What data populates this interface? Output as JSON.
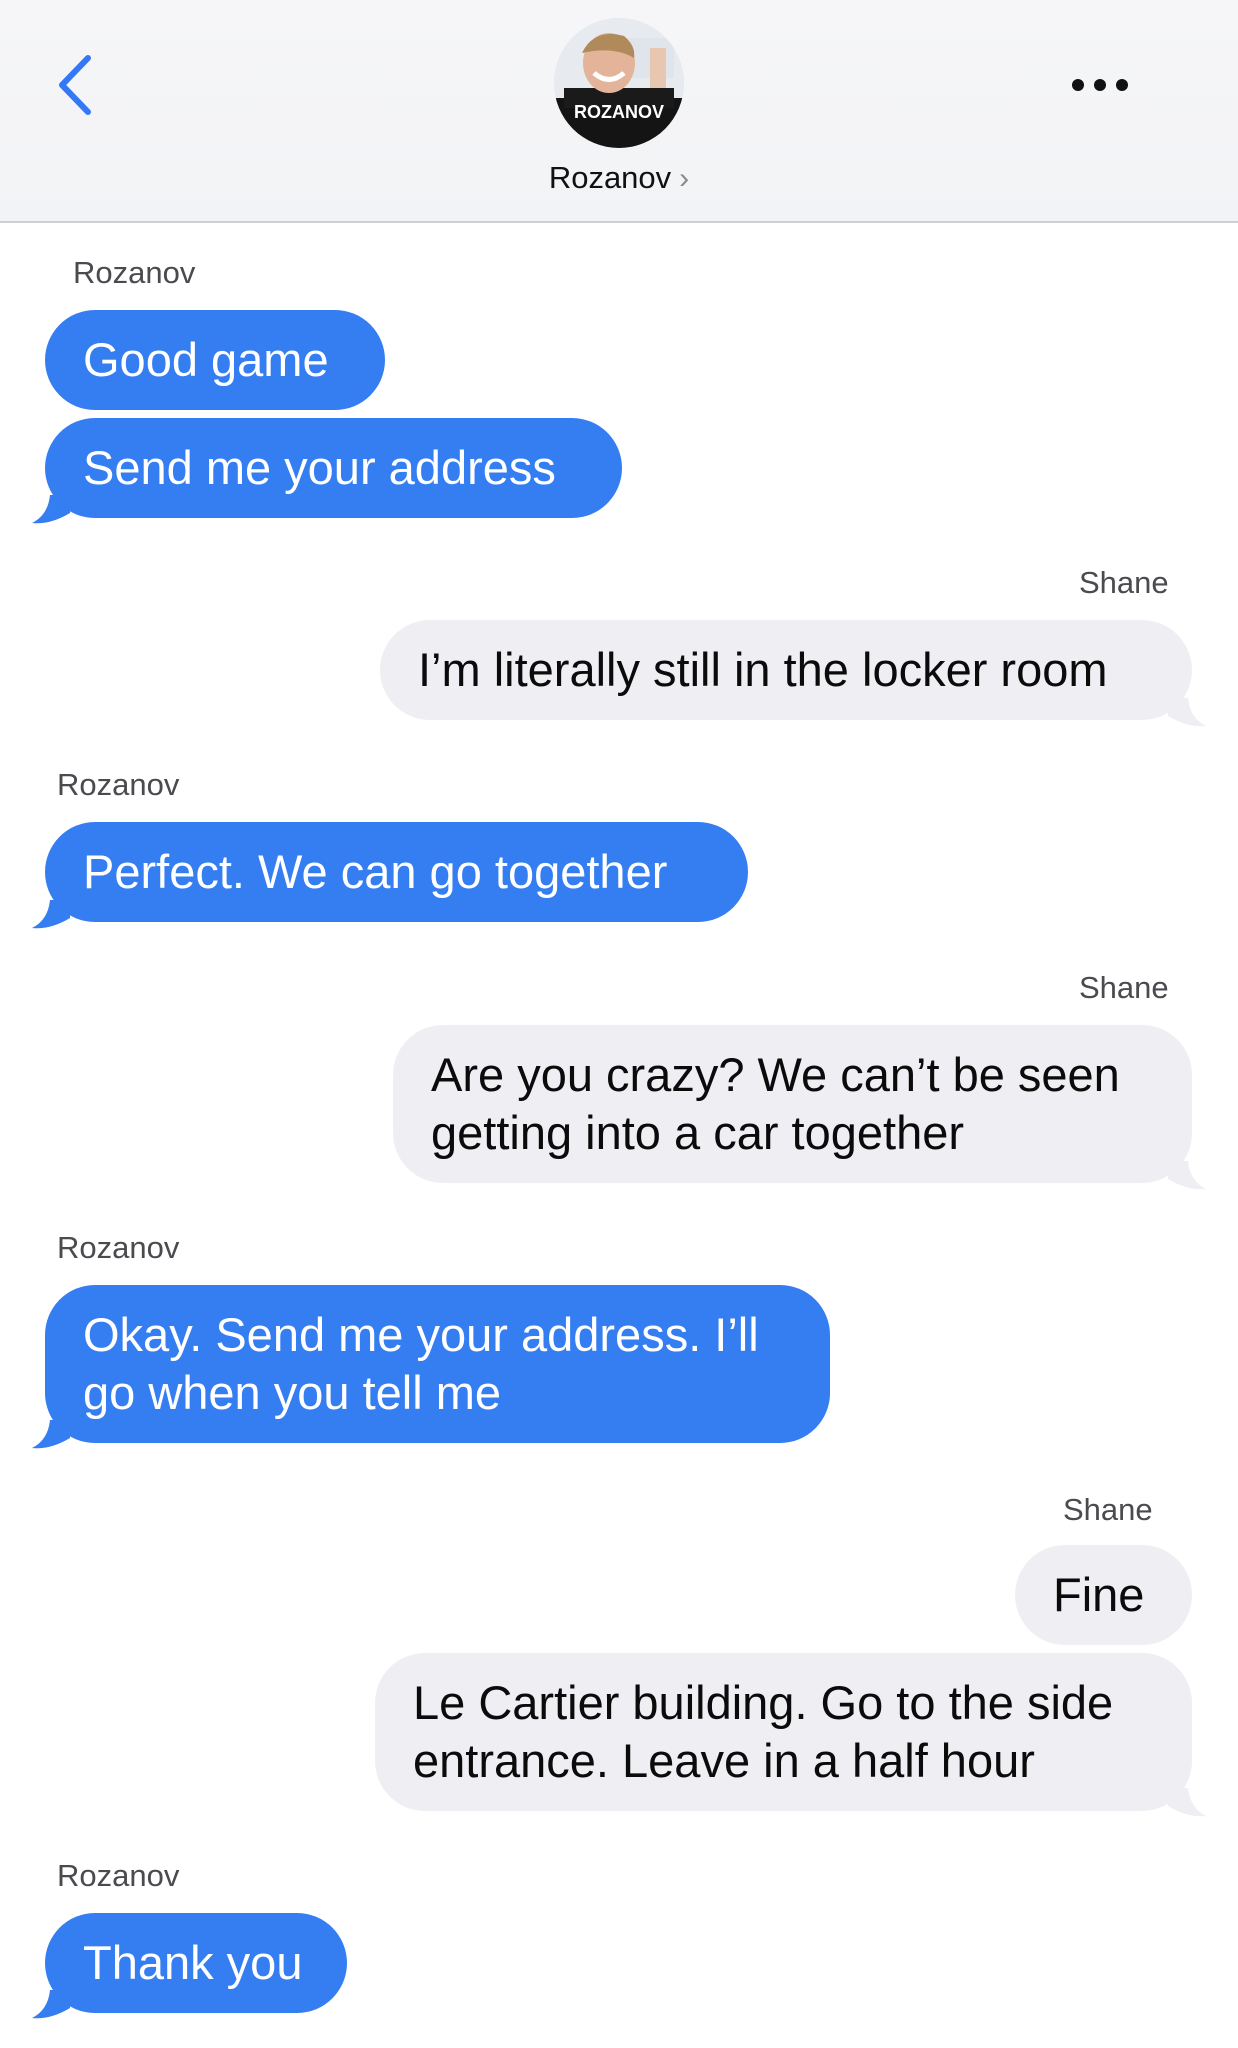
{
  "header": {
    "contact_name": "Rozanov",
    "chevron": "›",
    "avatar_text": "ROZANOV",
    "icons": {
      "back": "chevron-left-icon",
      "more": "more-horizontal-icon"
    },
    "accent_color": "#357EF2"
  },
  "messages": [
    {
      "sender": "Rozanov",
      "direction": "incoming",
      "text": "Good game"
    },
    {
      "sender": "Rozanov",
      "direction": "incoming",
      "text": "Send me your address"
    },
    {
      "sender": "Shane",
      "direction": "outgoing",
      "text": "I’m literally still in the locker room"
    },
    {
      "sender": "Rozanov",
      "direction": "incoming",
      "text": "Perfect. We can go together"
    },
    {
      "sender": "Shane",
      "direction": "outgoing",
      "text": "Are you crazy? We can’t be seen getting into a car together"
    },
    {
      "sender": "Rozanov",
      "direction": "incoming",
      "text": "Okay. Send me your address. I’ll go when you tell me"
    },
    {
      "sender": "Shane",
      "direction": "outgoing",
      "text": "Fine"
    },
    {
      "sender": "Shane",
      "direction": "outgoing",
      "text": "Le Cartier building. Go to the side entrance. Leave in a half hour"
    },
    {
      "sender": "Rozanov",
      "direction": "incoming",
      "text": "Thank you"
    }
  ],
  "colors": {
    "incoming_bubble": "#357EF2",
    "outgoing_bubble": "#EFEFF3"
  }
}
